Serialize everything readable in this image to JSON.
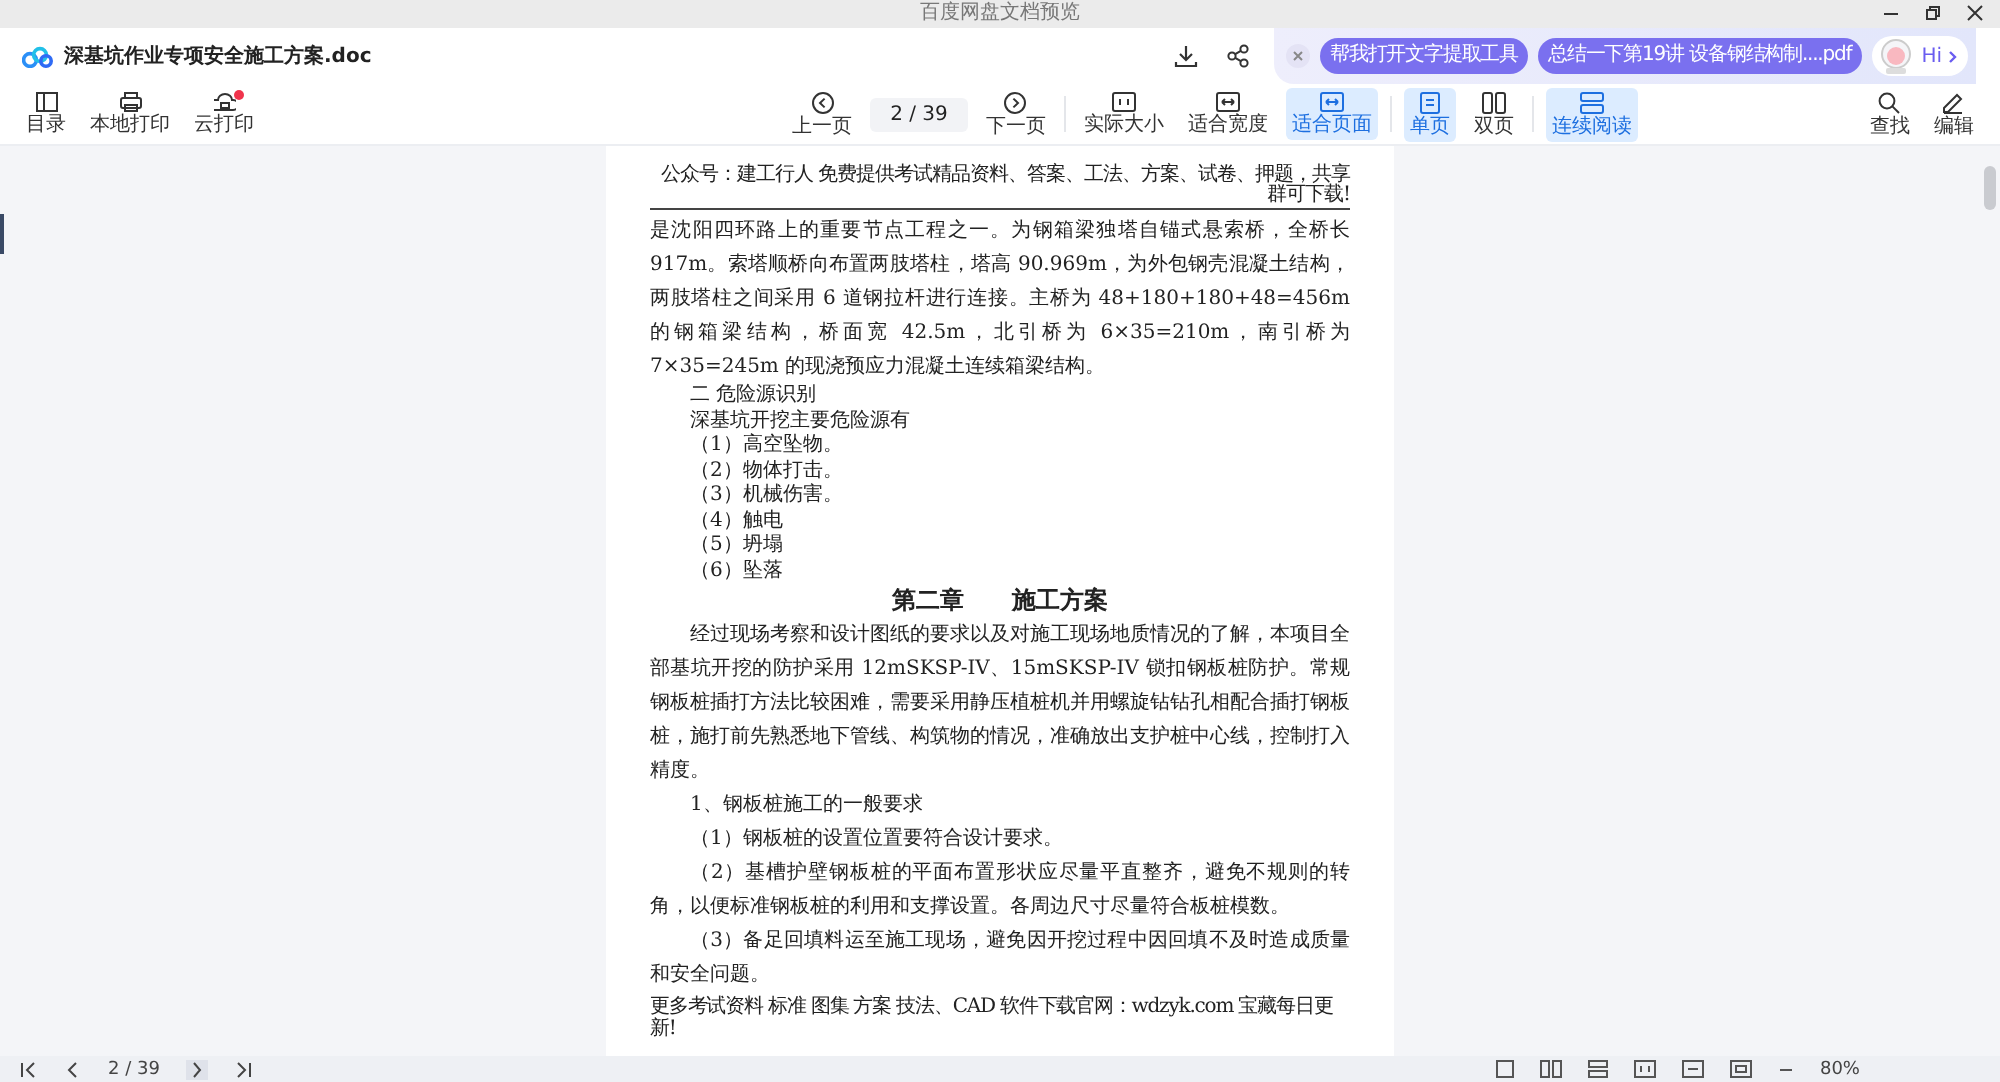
{
  "window": {
    "title": "百度网盘文档预览"
  },
  "file": {
    "name": "深基坑作业专项安全施工方案.doc"
  },
  "assistant": {
    "chips": [
      "帮我打开文字提取工具",
      "总结一下第19讲  设备钢结构制....pdf"
    ],
    "greeting": "Hi"
  },
  "toolbar": {
    "left": [
      {
        "label": "目录",
        "badge": false
      },
      {
        "label": "本地打印",
        "badge": false
      },
      {
        "label": "云打印",
        "badge": true
      }
    ],
    "prev": "上一页",
    "page": "2 / 39",
    "next": "下一页",
    "view": [
      {
        "label": "实际大小",
        "selected": false
      },
      {
        "label": "适合宽度",
        "selected": false
      },
      {
        "label": "适合页面",
        "selected": true
      }
    ],
    "layout": [
      {
        "label": "单页",
        "selected": true
      },
      {
        "label": "双页",
        "selected": false
      }
    ],
    "mode": [
      {
        "label": "连续阅读",
        "selected": true
      }
    ],
    "right": [
      "查找",
      "编辑"
    ]
  },
  "document": {
    "header": "公众号：建工行人 免费提供考试精品资料、答案、工法、方案、试卷、押题，共享群可下载!",
    "blocks": [
      {
        "kind": "continuation",
        "text": "是沈阳四环路上的重要节点工程之一。为钢箱梁独塔自锚式悬索桥，全桥长 917m。索塔顺桥向布置两肢塔柱，塔高 90.969m，为外包钢壳混凝土结构，两肢塔柱之间采用 6 道钢拉杆进行连接。主桥为 48+180+180+48=456m 的钢箱梁结构，桥面宽 42.5m，北引桥为 6×35=210m，南引桥为 7×35=245m 的现浇预应力混凝土连续箱梁结构。"
      },
      {
        "kind": "item",
        "text": "二 危险源识别"
      },
      {
        "kind": "item",
        "text": "深基坑开挖主要危险源有"
      },
      {
        "kind": "item",
        "text": "（1）高空坠物。"
      },
      {
        "kind": "item",
        "text": "（2）物体打击。"
      },
      {
        "kind": "item",
        "text": "（3）机械伤害。"
      },
      {
        "kind": "item",
        "text": "（4）触电"
      },
      {
        "kind": "item",
        "text": "（5）坍塌"
      },
      {
        "kind": "item",
        "text": "（6）坠落"
      },
      {
        "kind": "chapter",
        "text": "第二章　　施工方案"
      },
      {
        "kind": "body",
        "text": "经过现场考察和设计图纸的要求以及对施工现场地质情况的了解，本项目全部基坑开挖的防护采用 12mSKSP-IV、15mSKSP-IV 锁扣钢板桩防护。常规钢板桩插打方法比较困难，需要采用静压植桩机并用螺旋钻钻孔相配合插打钢板桩，施打前先熟悉地下管线、构筑物的情况，准确放出支护桩中心线，控制打入精度。"
      },
      {
        "kind": "body",
        "text": "1、钢板桩施工的一般要求"
      },
      {
        "kind": "body",
        "text": "（1）钢板桩的设置位置要符合设计要求。"
      },
      {
        "kind": "body",
        "text": "（2）基槽护壁钢板桩的平面布置形状应尽量平直整齐，避免不规则的转角，以便标准钢板桩的利用和支撑设置。各周边尺寸尽量符合板桩模数。"
      },
      {
        "kind": "body",
        "text": "（3）备足回填料运至施工现场，避免因开挖过程中因回填不及时造成质量和安全问题。"
      }
    ],
    "footer": "更多考试资料 标准 图集 方案 技法、CAD 软件下载官网：wdzyk.com 宝藏每日更新!"
  },
  "bottom": {
    "page": "2 / 39",
    "zoom": "80%"
  }
}
